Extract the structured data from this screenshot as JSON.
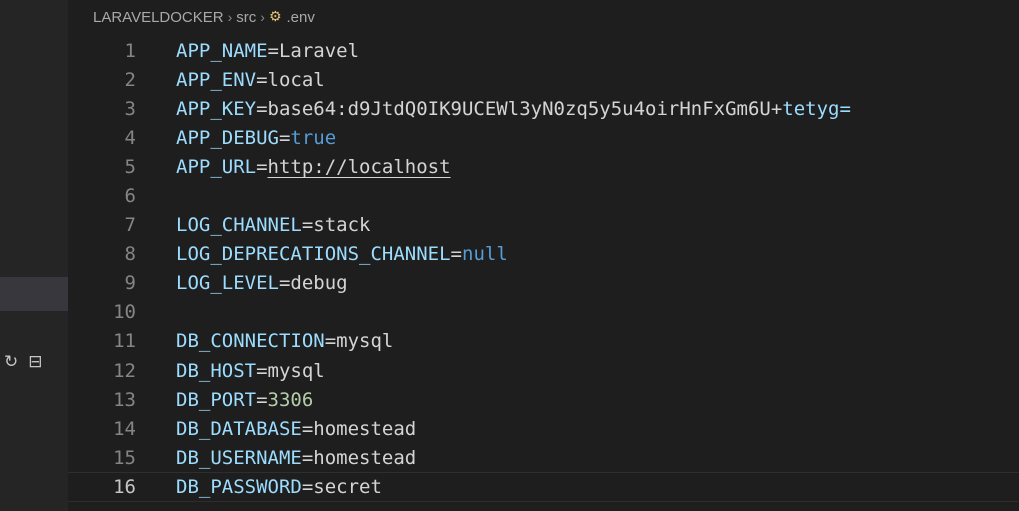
{
  "breadcrumb": {
    "root": "LARAVELDOCKER",
    "folder": "src",
    "file": ".env",
    "file_icon": "gear-env-icon",
    "separator": "›"
  },
  "sidebar": {
    "icons": [
      "refresh-icon",
      "collapse-all-icon"
    ]
  },
  "editor": {
    "current_line": 16,
    "lines": [
      {
        "number": "1",
        "key": "APP_NAME",
        "eq": "=",
        "value": "Laravel",
        "kind": "plain"
      },
      {
        "number": "2",
        "key": "APP_ENV",
        "eq": "=",
        "value": "local",
        "kind": "plain"
      },
      {
        "number": "3",
        "key": "APP_KEY",
        "eq": "=",
        "value": "base64:d9JtdQ0IK9UCEWl3yN0zq5y5u4oirHnFxGm6U+",
        "value2": "tetyg=",
        "kind": "plain"
      },
      {
        "number": "4",
        "key": "APP_DEBUG",
        "eq": "=",
        "value": "true",
        "kind": "bool"
      },
      {
        "number": "5",
        "key": "APP_URL",
        "eq": "=",
        "value": "http://localhost",
        "kind": "url"
      },
      {
        "number": "6",
        "key": "",
        "eq": "",
        "value": "",
        "kind": "empty"
      },
      {
        "number": "7",
        "key": "LOG_CHANNEL",
        "eq": "=",
        "value": "stack",
        "kind": "plain"
      },
      {
        "number": "8",
        "key": "LOG_DEPRECATIONS_CHANNEL",
        "eq": "=",
        "value": "null",
        "kind": "bool"
      },
      {
        "number": "9",
        "key": "LOG_LEVEL",
        "eq": "=",
        "value": "debug",
        "kind": "plain"
      },
      {
        "number": "10",
        "key": "",
        "eq": "",
        "value": "",
        "kind": "empty"
      },
      {
        "number": "11",
        "key": "DB_CONNECTION",
        "eq": "=",
        "value": "mysql",
        "kind": "plain"
      },
      {
        "number": "12",
        "key": "DB_HOST",
        "eq": "=",
        "value": "mysql",
        "kind": "plain"
      },
      {
        "number": "13",
        "key": "DB_PORT",
        "eq": "=",
        "value": "3306",
        "kind": "num"
      },
      {
        "number": "14",
        "key": "DB_DATABASE",
        "eq": "=",
        "value": "homestead",
        "kind": "plain"
      },
      {
        "number": "15",
        "key": "DB_USERNAME",
        "eq": "=",
        "value": "homestead",
        "kind": "plain"
      },
      {
        "number": "16",
        "key": "DB_PASSWORD",
        "eq": "=",
        "value": "secret",
        "kind": "plain"
      }
    ]
  }
}
